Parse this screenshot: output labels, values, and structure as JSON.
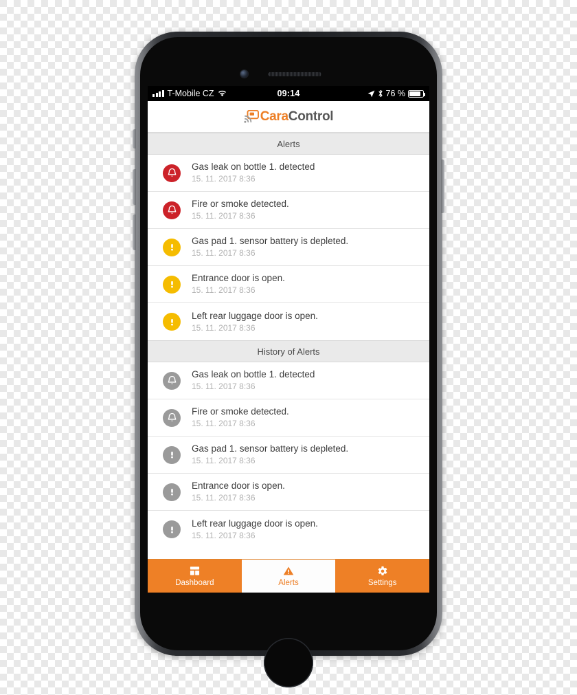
{
  "statusbar": {
    "carrier": "T-Mobile CZ",
    "time": "09:14",
    "battery_percent": "76 %",
    "icons": [
      "signal-bars-icon",
      "wifi-icon",
      "location-arrow-icon",
      "bluetooth-icon",
      "battery-icon"
    ]
  },
  "navbar": {
    "logo_mark": "caracontrol-wifi-logo-icon",
    "logo_part1": "Cara",
    "logo_part2": "Control"
  },
  "sections": [
    {
      "header": "Alerts",
      "items": [
        {
          "icon": "bell-icon",
          "severity": "critical",
          "title": "Gas leak on bottle 1. detected",
          "time": "15. 11. 2017  8:36"
        },
        {
          "icon": "bell-icon",
          "severity": "critical",
          "title": "Fire or smoke detected.",
          "time": "15. 11. 2017  8:36"
        },
        {
          "icon": "exclamation-icon",
          "severity": "warning",
          "title": "Gas pad 1. sensor battery is depleted.",
          "time": "15. 11. 2017  8:36"
        },
        {
          "icon": "exclamation-icon",
          "severity": "warning",
          "title": "Entrance door is open.",
          "time": "15. 11. 2017  8:36"
        },
        {
          "icon": "exclamation-icon",
          "severity": "warning",
          "title": "Left rear luggage door is open.",
          "time": "15. 11. 2017  8:36"
        }
      ]
    },
    {
      "header": "History of Alerts",
      "items": [
        {
          "icon": "bell-icon",
          "severity": "past",
          "title": "Gas leak on bottle 1. detected",
          "time": "15. 11. 2017  8:36"
        },
        {
          "icon": "bell-icon",
          "severity": "past",
          "title": "Fire or smoke detected.",
          "time": "15. 11. 2017  8:36"
        },
        {
          "icon": "exclamation-icon",
          "severity": "past",
          "title": "Gas pad 1. sensor battery is depleted.",
          "time": "15. 11. 2017  8:36"
        },
        {
          "icon": "exclamation-icon",
          "severity": "past",
          "title": "Entrance door is open.",
          "time": "15. 11. 2017  8:36"
        },
        {
          "icon": "exclamation-icon",
          "severity": "past",
          "title": "Left rear luggage door is open.",
          "time": "15. 11. 2017  8:36"
        }
      ]
    }
  ],
  "tabbar": {
    "tabs": [
      {
        "label": "Dashboard",
        "icon": "dashboard-grid-icon",
        "active": false
      },
      {
        "label": "Alerts",
        "icon": "warning-triangle-icon",
        "active": true
      },
      {
        "label": "Settings",
        "icon": "gear-icon",
        "active": false
      }
    ]
  },
  "colors": {
    "accent_orange": "#EE8026",
    "logo_orange": "#ED7F26",
    "critical_red": "#CC2229",
    "warning_amber": "#F5BC00",
    "past_gray": "#9A9A9A",
    "section_bg": "#EAEAEA"
  }
}
